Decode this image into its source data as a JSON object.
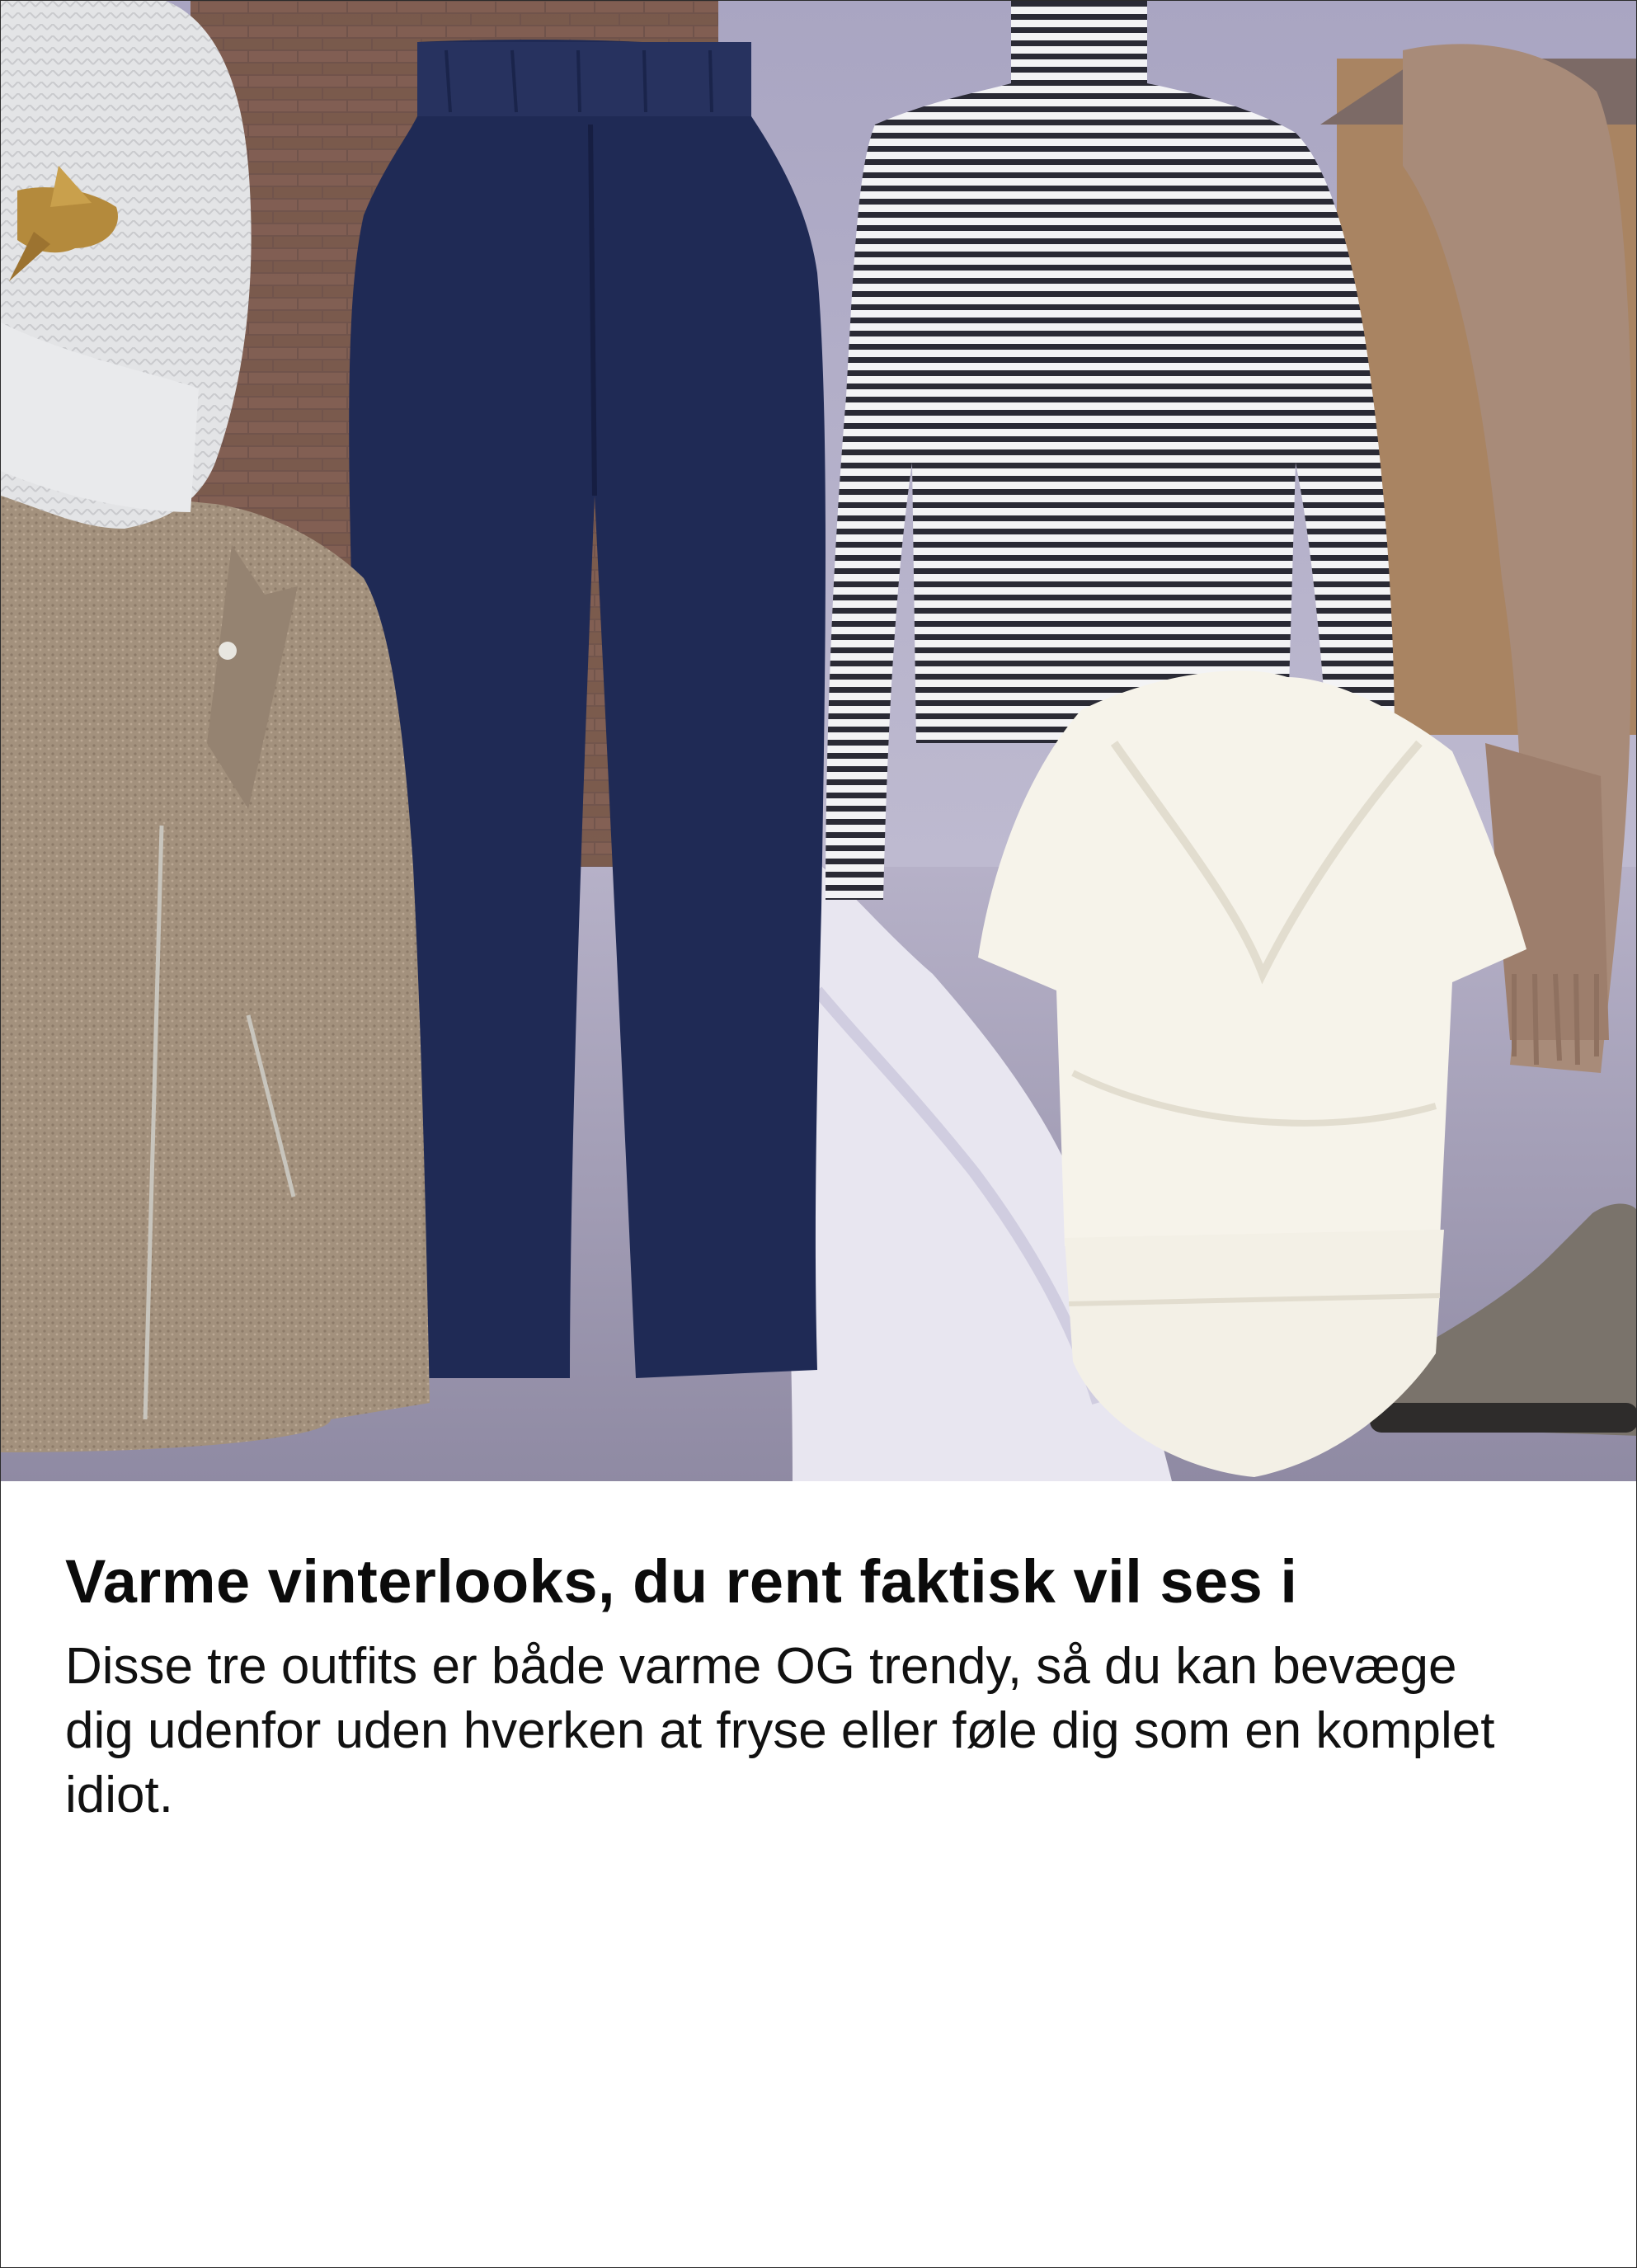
{
  "article": {
    "headline": "Varme vinterlooks, du rent faktisk vil ses i",
    "description": "Disse tre outfits er både varme OG trendy, så du kan bevæge dig udenfor uden hverken at fryse eller føle dig som en komplet idiot."
  },
  "hero": {
    "items": [
      "beanie-hat",
      "wool-jacket",
      "navy-trousers",
      "striped-turtleneck",
      "white-wrap-bodysuit",
      "knit-scarf",
      "ankle-boot"
    ]
  },
  "colors": {
    "sky": "#bcb9cf",
    "navy": "#1f2a55",
    "wool": "#a08f7c",
    "scarf": "#a88b79",
    "snow": "#e9e7f1",
    "text": "#0b0b0b"
  }
}
